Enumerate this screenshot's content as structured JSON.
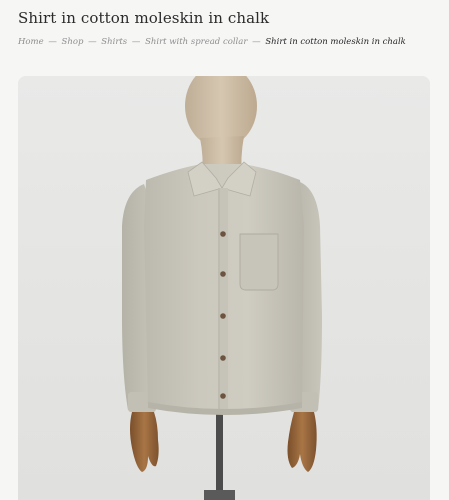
{
  "page": {
    "title": "Shirt in cotton moleskin in chalk"
  },
  "breadcrumb": {
    "items": [
      "Home",
      "Shop",
      "Shirts",
      "Shirt with spread collar"
    ],
    "separator": "—",
    "current": "Shirt in cotton moleskin in chalk"
  },
  "colors": {
    "background": "#f6f6f5",
    "card_background": "#e5e5e4",
    "shirt": "#c9c6bb",
    "mannequin": "#cdbda6",
    "hands": "#9a6a3f",
    "stand": "#4a4a4a"
  }
}
